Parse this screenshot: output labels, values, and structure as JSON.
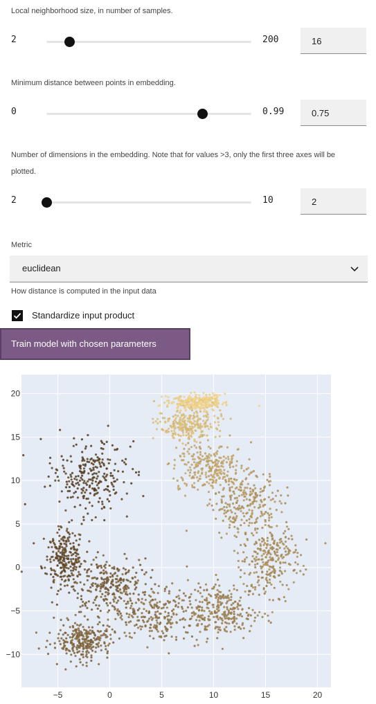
{
  "params": {
    "n_neighbors": {
      "description": "Local neighborhood size, in number of samples.",
      "min": "2",
      "max": "200",
      "value": "16",
      "fraction": 0.11
    },
    "min_dist": {
      "description": "Minimum distance between points in embedding.",
      "min": "0",
      "max": "0.99",
      "value": "0.75",
      "fraction": 0.76
    },
    "n_components": {
      "description": "Number of dimensions in the embedding. Note that for values >3, only the first three axes will be plotted.",
      "min": "2",
      "max": "10",
      "value": "2",
      "fraction": 0.0
    }
  },
  "metric": {
    "label": "Metric",
    "value": "euclidean",
    "help": "How distance is computed in the input data",
    "chevron_icon": "chevron-down-icon"
  },
  "standardize": {
    "label": "Standardize input product",
    "checked": true,
    "check_icon": "checkmark-icon"
  },
  "train_button": {
    "label": "Train model with chosen parameters"
  },
  "colors": {
    "accent": "#7b5a85",
    "plot_bg": "#e5ecf6",
    "point_dark": "#4a3119",
    "point_light": "#f3d48a"
  },
  "chart_data": {
    "type": "scatter",
    "title": "",
    "xlabel": "",
    "ylabel": "",
    "xlim": [
      -8.5,
      21.3
    ],
    "ylim": [
      -13.8,
      22.2
    ],
    "x_ticks": [
      -5,
      0,
      5,
      10,
      15,
      20
    ],
    "y_ticks": [
      -10,
      -5,
      0,
      5,
      10,
      15,
      20
    ],
    "x_tick_labels": [
      "−5",
      "0",
      "5",
      "10",
      "15",
      "20"
    ],
    "y_tick_labels": [
      "−10",
      "−5",
      "0",
      "5",
      "10",
      "15",
      "20"
    ],
    "grid": true,
    "series": [
      {
        "color_range": [
          "#4a3119",
          "#f3d48a"
        ],
        "clusters": [
          {
            "center": [
              -2.0,
              10.5
            ],
            "spread": [
              3.3,
              3.8
            ],
            "shade": 0.08
          },
          {
            "center": [
              -4.5,
              1.0
            ],
            "spread": [
              1.8,
              3.2
            ],
            "shade": 0.15
          },
          {
            "center": [
              0.0,
              -2.0
            ],
            "spread": [
              3.5,
              3.0
            ],
            "shade": 0.25
          },
          {
            "center": [
              -2.5,
              -8.5
            ],
            "spread": [
              2.5,
              2.0
            ],
            "shade": 0.32
          },
          {
            "center": [
              4.5,
              -5.5
            ],
            "spread": [
              4.0,
              3.0
            ],
            "shade": 0.4
          },
          {
            "center": [
              11.0,
              -5.0
            ],
            "spread": [
              3.0,
              3.0
            ],
            "shade": 0.48
          },
          {
            "center": [
              15.5,
              1.0
            ],
            "spread": [
              2.5,
              4.0
            ],
            "shade": 0.55
          },
          {
            "center": [
              13.0,
              7.5
            ],
            "spread": [
              3.0,
              3.5
            ],
            "shade": 0.6
          },
          {
            "center": [
              9.5,
              11.5
            ],
            "spread": [
              3.0,
              2.5
            ],
            "shade": 0.7
          },
          {
            "center": [
              7.5,
              16.5
            ],
            "spread": [
              2.5,
              1.5
            ],
            "shade": 0.85
          },
          {
            "center": [
              8.5,
              19.0
            ],
            "spread": [
              2.5,
              0.8
            ],
            "shade": 0.97
          }
        ]
      }
    ]
  }
}
